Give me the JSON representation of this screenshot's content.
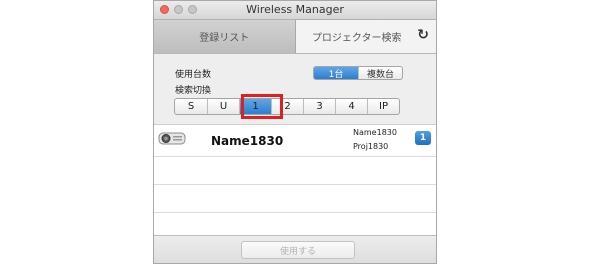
{
  "window": {
    "title": "Wireless Manager"
  },
  "tabs": [
    {
      "label": "登録リスト",
      "active": false
    },
    {
      "label": "プロジェクター検索",
      "active": true
    }
  ],
  "refresh_icon": "refresh-icon",
  "settings": {
    "usage_label": "使用台数",
    "usage_options": [
      "1台",
      "複数台"
    ],
    "usage_selected": "1台",
    "search_label": "検索切換",
    "search_options": [
      "S",
      "U",
      "1",
      "2",
      "3",
      "4",
      "IP"
    ],
    "search_selected": "1"
  },
  "projectors": [
    {
      "icon": "projector-icon",
      "name": "Name1830",
      "sub_name": "Name1830",
      "sub_id": "Proj1830",
      "badge": "1"
    }
  ],
  "footer": {
    "use_button_label": "使用する"
  },
  "colors": {
    "accent": "#2d7ed0",
    "highlight": "#e02020"
  }
}
